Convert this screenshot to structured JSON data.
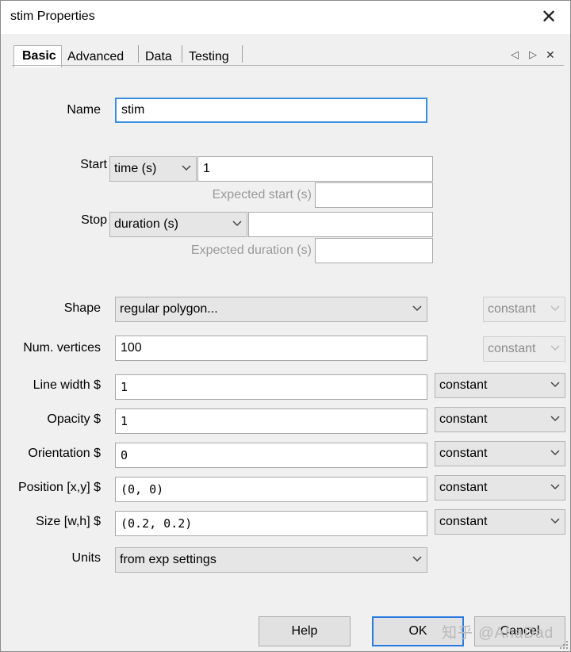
{
  "window": {
    "title": "stim Properties"
  },
  "tabs": [
    {
      "label": "Basic"
    },
    {
      "label": "Advanced"
    },
    {
      "label": "Data"
    },
    {
      "label": "Testing"
    }
  ],
  "tab_nav": {
    "left": "◁",
    "right": "▷",
    "close": "✕"
  },
  "fields": {
    "name": {
      "label": "Name",
      "value": "stim"
    },
    "start": {
      "label": "Start",
      "type": "time (s)",
      "value": "1",
      "expected_label": "Expected start (s)",
      "expected_value": ""
    },
    "stop": {
      "label": "Stop",
      "type": "duration (s)",
      "value": "",
      "expected_label": "Expected duration (s)",
      "expected_value": ""
    },
    "shape": {
      "label": "Shape",
      "value": "regular polygon...",
      "update": "constant"
    },
    "num_vertices": {
      "label": "Num. vertices",
      "value": "100",
      "update": "constant"
    },
    "line_width": {
      "label": "Line width $",
      "value": "1",
      "update": "constant"
    },
    "opacity": {
      "label": "Opacity $",
      "value": "1",
      "update": "constant"
    },
    "orientation": {
      "label": "Orientation $",
      "value": "0",
      "update": "constant"
    },
    "position": {
      "label": "Position [x,y] $",
      "value": "(0, 0)",
      "update": "constant"
    },
    "size": {
      "label": "Size [w,h] $",
      "value": "(0.2, 0.2)",
      "update": "constant"
    },
    "units": {
      "label": "Units",
      "value": "from exp settings"
    }
  },
  "buttons": {
    "help": "Help",
    "ok": "OK",
    "cancel": "Cancel"
  },
  "watermark": "知乎 @AhaDad",
  "colors": {
    "focus_border": "#3a8ee0",
    "default_button_border": "#2a7be0"
  }
}
